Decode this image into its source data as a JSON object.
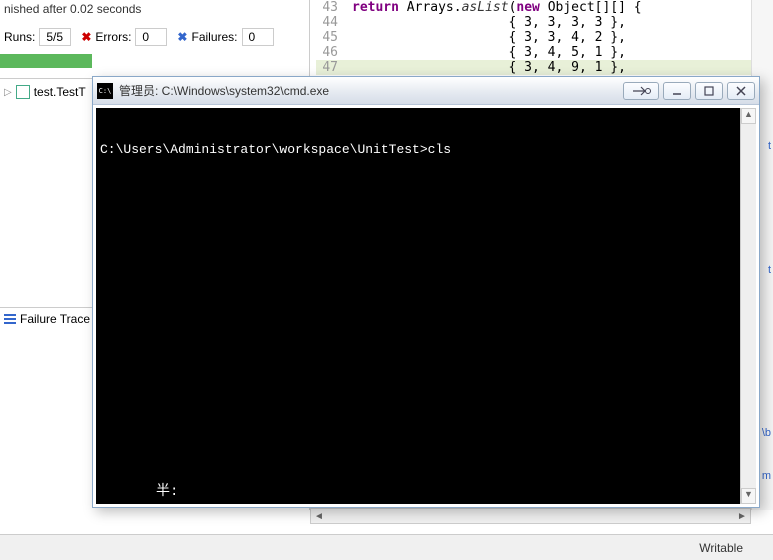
{
  "junit": {
    "finished_text": "nished after 0.02 seconds",
    "runs_label": "Runs:",
    "runs_val": "5/5",
    "errors_label": "Errors:",
    "errors_val": "0",
    "failures_label": "Failures:",
    "failures_val": "0",
    "tree_item": "test.TestT",
    "failure_trace_label": "Failure Trace"
  },
  "code": {
    "lines": [
      {
        "n": "43",
        "t": "            return Arrays.asList(new Object[][] {"
      },
      {
        "n": "44",
        "t": "                    { 3, 3, 3, 3 },"
      },
      {
        "n": "45",
        "t": "                    { 3, 3, 4, 2 },"
      },
      {
        "n": "46",
        "t": "                    { 3, 4, 5, 1 },"
      },
      {
        "n": "47",
        "t": "                    { 3, 4, 9, 1 },"
      }
    ],
    "right_markers": [
      "t",
      "t",
      "\\b",
      "m"
    ]
  },
  "statusbar": {
    "writable": "Writable"
  },
  "cmd": {
    "icon_text": "C:\\",
    "title": "管理员: C:\\Windows\\system32\\cmd.exe",
    "prompt_line": "C:\\Users\\Administrator\\workspace\\UnitTest>cls",
    "ime": "半:"
  }
}
